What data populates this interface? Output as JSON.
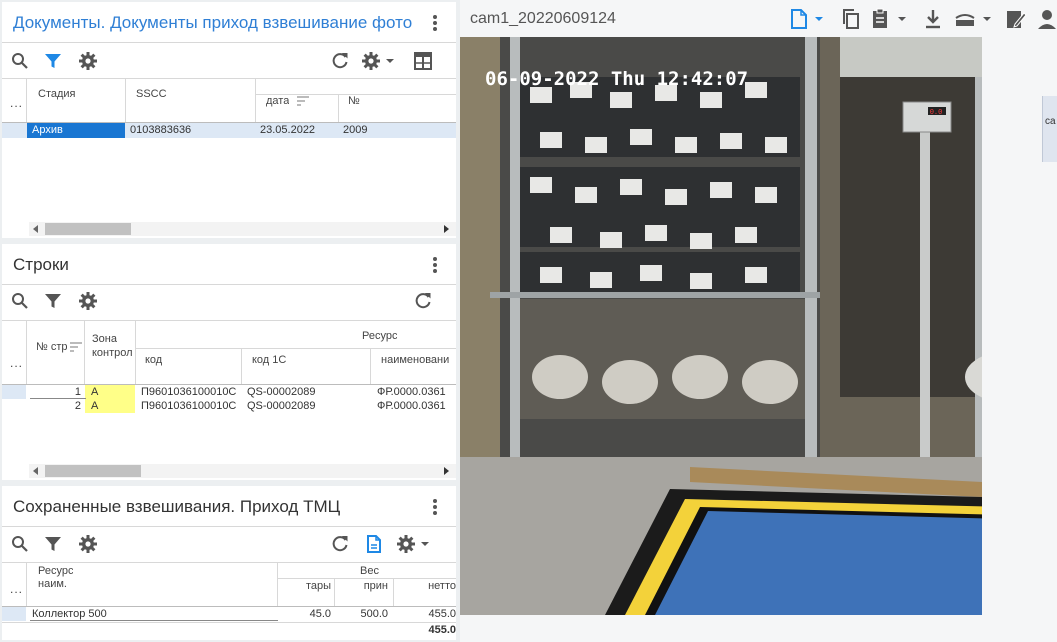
{
  "documents": {
    "title": "Документы. Документы приход взвешивание фото",
    "columns": {
      "stage": "Стадия",
      "sscc": "SSCC",
      "date": "дата",
      "number": "№"
    },
    "row": {
      "stage": "Архив",
      "sscc": "0103883636",
      "date": "23.05.2022",
      "number": "2009"
    },
    "more": "..."
  },
  "lines": {
    "title": "Строки",
    "columns": {
      "line_no": "№ стр",
      "zone": "Зона контрол",
      "resource": "Ресурс",
      "code": "код",
      "code1c": "код 1С",
      "name": "наименовани"
    },
    "rows": [
      {
        "n": "1",
        "zone": "А",
        "code": "П9601036100010С",
        "code1c": "QS-00002089",
        "name": "ФР.0000.0361"
      },
      {
        "n": "2",
        "zone": "А",
        "code": "П9601036100010С",
        "code1c": "QS-00002089",
        "name": "ФР.0000.0361"
      }
    ],
    "more": "..."
  },
  "weighings": {
    "title": "Сохраненные взвешивания. Приход ТМЦ",
    "columns": {
      "resource": "Ресурс",
      "name": "наим.",
      "weight": "Вес",
      "tare": "тары",
      "accepted": "прин",
      "net": "нетто"
    },
    "row": {
      "name": "Коллектор 500",
      "tare": "45.0",
      "accepted": "500.0",
      "net": "455.0"
    },
    "total_net": "455.0",
    "more": "..."
  },
  "viewer": {
    "filename": "cam1_20220609124",
    "overlay_text": "06-09-2022 Thu 12:42:07",
    "scale_display": "0.0",
    "side_label": "са"
  },
  "colors": {
    "accent": "#1e88e5",
    "selection": "#1976d2",
    "zone_highlight": "#ffff88",
    "selected_row": "#dde8f5"
  }
}
